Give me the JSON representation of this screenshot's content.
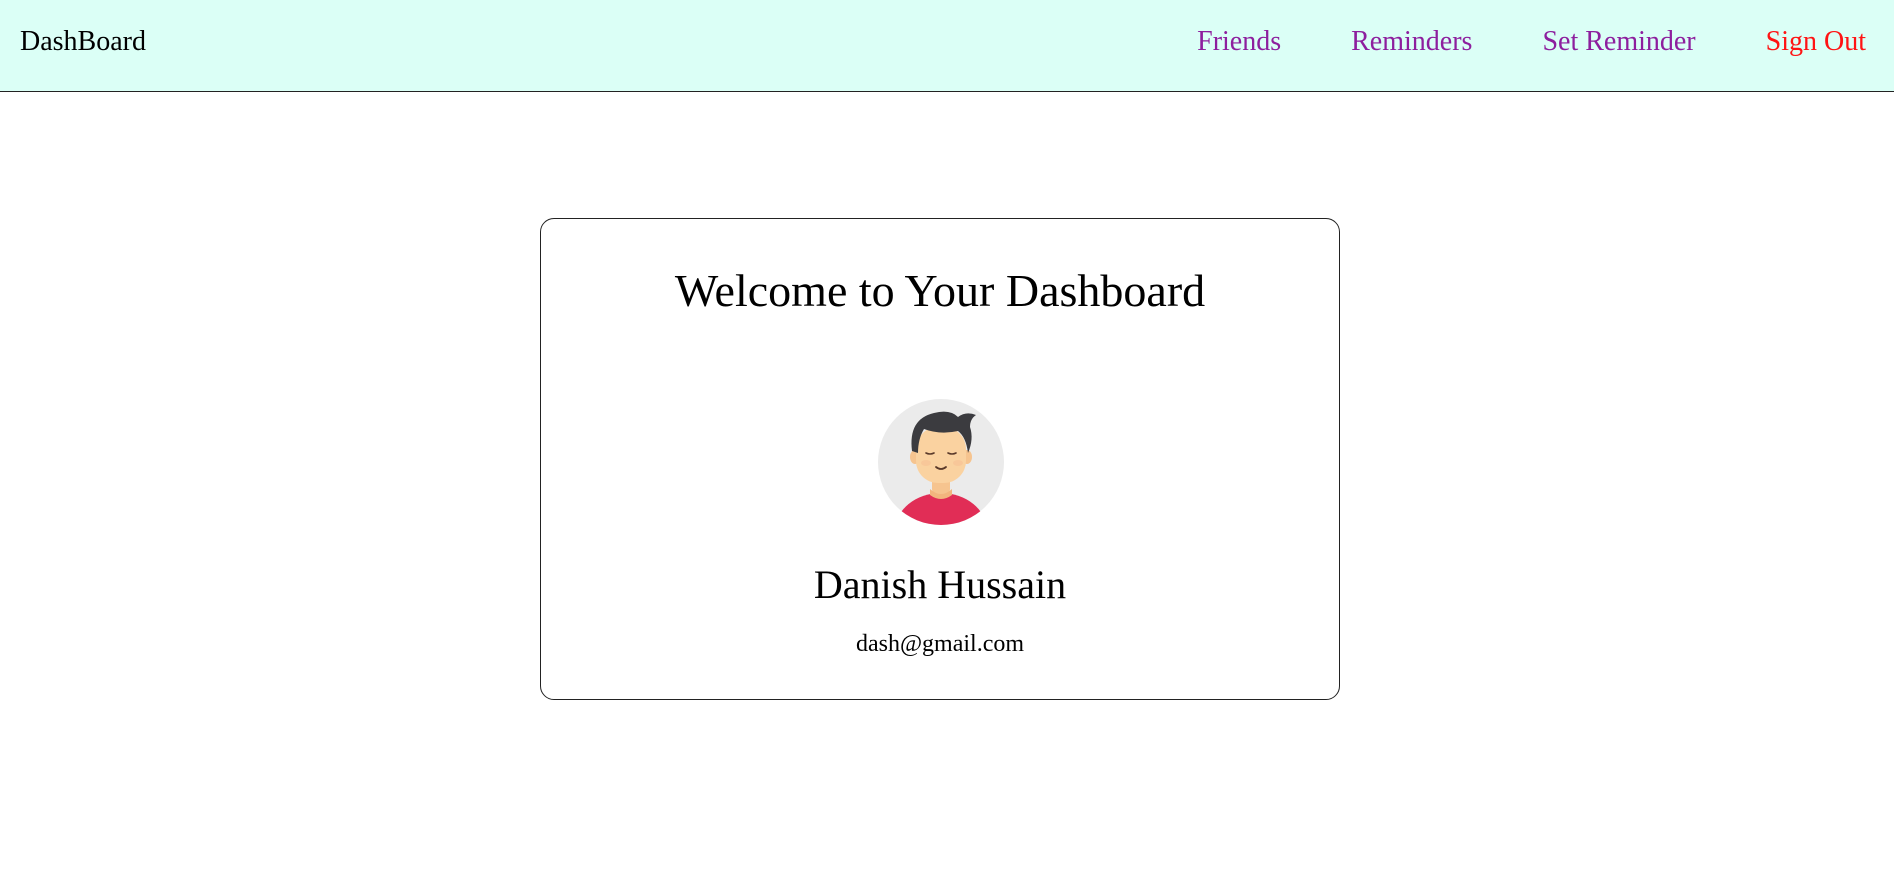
{
  "navbar": {
    "brand": "DashBoard",
    "links": [
      {
        "label": "Friends",
        "color": "#8d1f9e"
      },
      {
        "label": "Reminders",
        "color": "#8d1f9e"
      },
      {
        "label": "Set Reminder",
        "color": "#8d1f9e"
      },
      {
        "label": "Sign Out",
        "color": "#ff1414"
      }
    ],
    "background": "#dbfff6"
  },
  "card": {
    "title": "Welcome to Your Dashboard",
    "avatar_icon": "user-avatar-icon",
    "name": "Danish Hussain",
    "email": "dash@gmail.com"
  }
}
